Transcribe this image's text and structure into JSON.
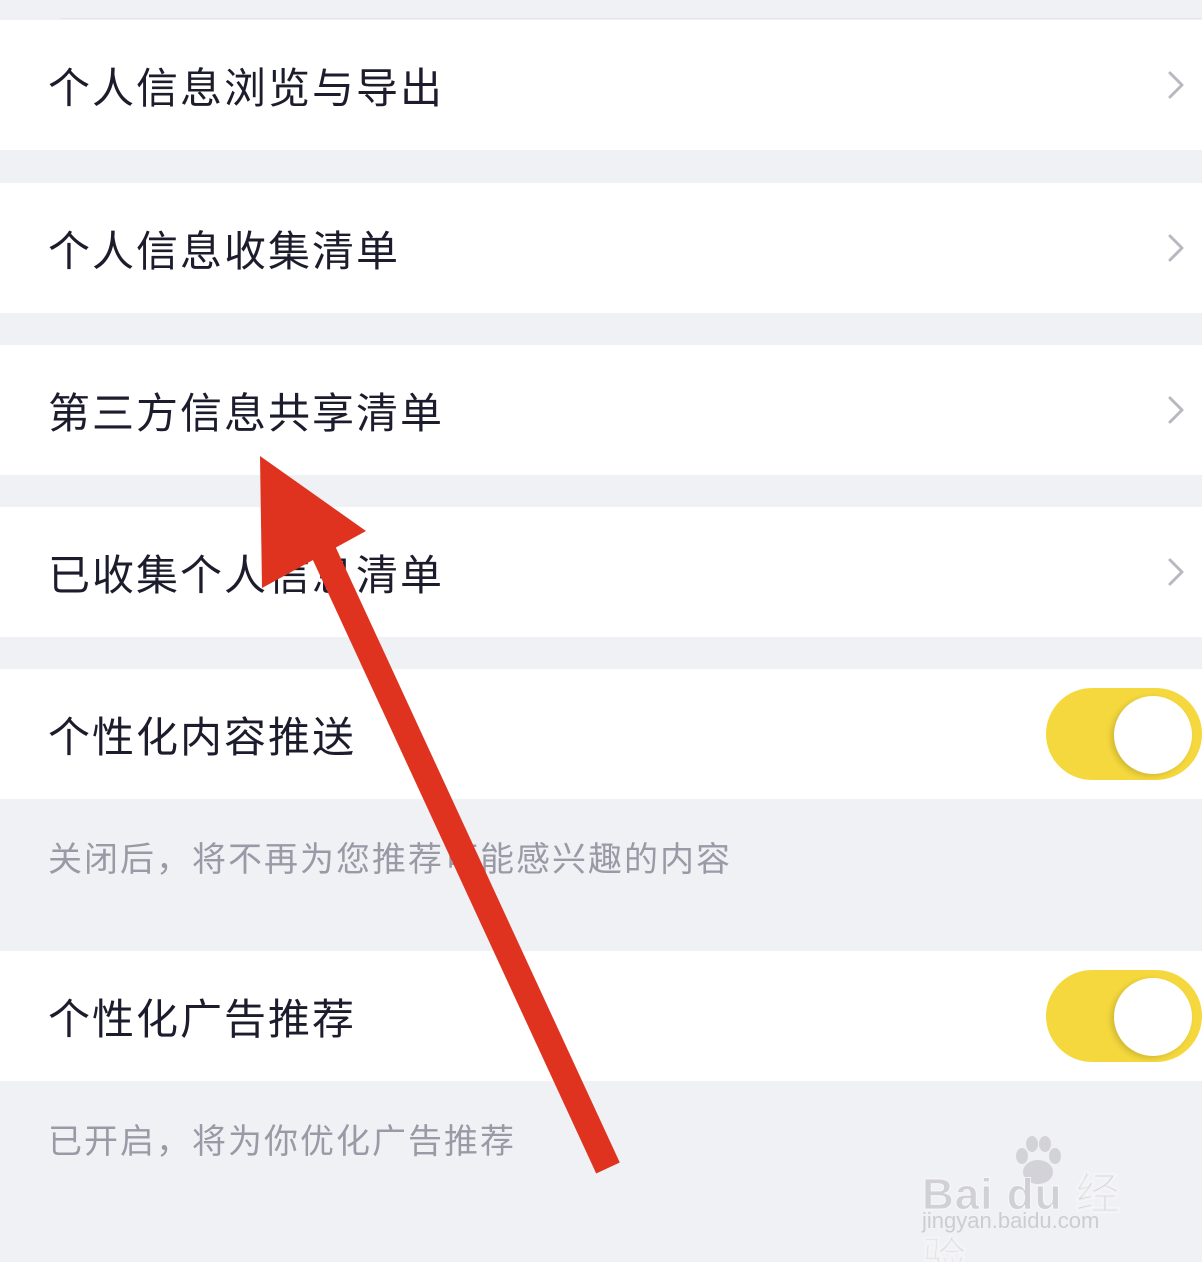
{
  "menu": {
    "items": [
      {
        "label": "个人信息浏览与导出",
        "icon": "chevron-right-icon"
      },
      {
        "label": "个人信息收集清单",
        "icon": "chevron-right-icon"
      },
      {
        "label": "第三方信息共享清单",
        "icon": "chevron-right-icon"
      },
      {
        "label": "已收集个人信息清单",
        "icon": "chevron-right-icon"
      }
    ]
  },
  "toggles": [
    {
      "label": "个性化内容推送",
      "on": true,
      "description": "关闭后，将不再为您推荐可能感兴趣的内容"
    },
    {
      "label": "个性化广告推荐",
      "on": true,
      "description": "已开启，将为你优化广告推荐"
    }
  ],
  "colors": {
    "toggle_on": "#f5d83d",
    "background": "#f0f1f5",
    "row": "#ffffff",
    "arrow": "#e0331f",
    "text": "#1c1c2c",
    "subtext": "#9a9aa6"
  },
  "watermark": {
    "logo": "Bai du 经验",
    "url": "jingyan.baidu.com"
  }
}
